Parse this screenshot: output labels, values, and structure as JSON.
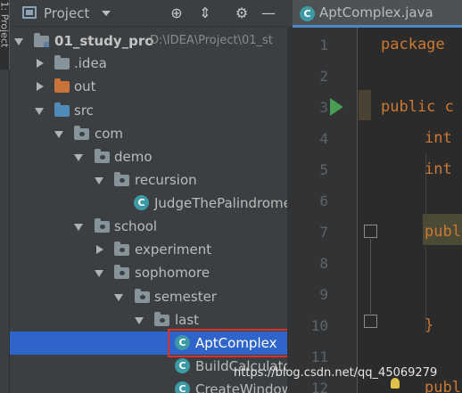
{
  "side_strip": {
    "tab_label": "1: Project"
  },
  "project_panel": {
    "title": "Project",
    "buttons": {
      "locate": "⊕",
      "collapse": "⇕",
      "settings": "⚙",
      "hide": "—"
    }
  },
  "tree": {
    "root_name": "01_study_pro",
    "root_path": "D:\\IDEA\\Project\\01_st",
    "idea": ".idea",
    "out": "out",
    "src": "src",
    "com": "com",
    "demo": "demo",
    "recursion": "recursion",
    "judge": "JudgeThePalindrome",
    "school": "school",
    "experiment": "experiment",
    "sophomore": "sophomore",
    "semester": "semester",
    "last": "last",
    "apt": "AptComplex",
    "build": "BuildCalculato",
    "create": "CreateWindow"
  },
  "editor": {
    "tab_label": "AptComplex.java",
    "line_numbers": [
      "1",
      "2",
      "3",
      "4",
      "5",
      "6",
      "7",
      "8",
      "9",
      "10",
      "11",
      "12"
    ],
    "code": {
      "l1": "package",
      "l3": "public c",
      "l4": "int",
      "l5": "int",
      "l7": "publ",
      "l10": "}",
      "l12": "publ"
    }
  },
  "watermark": "https://blog.csdn.net/qq_45069279"
}
